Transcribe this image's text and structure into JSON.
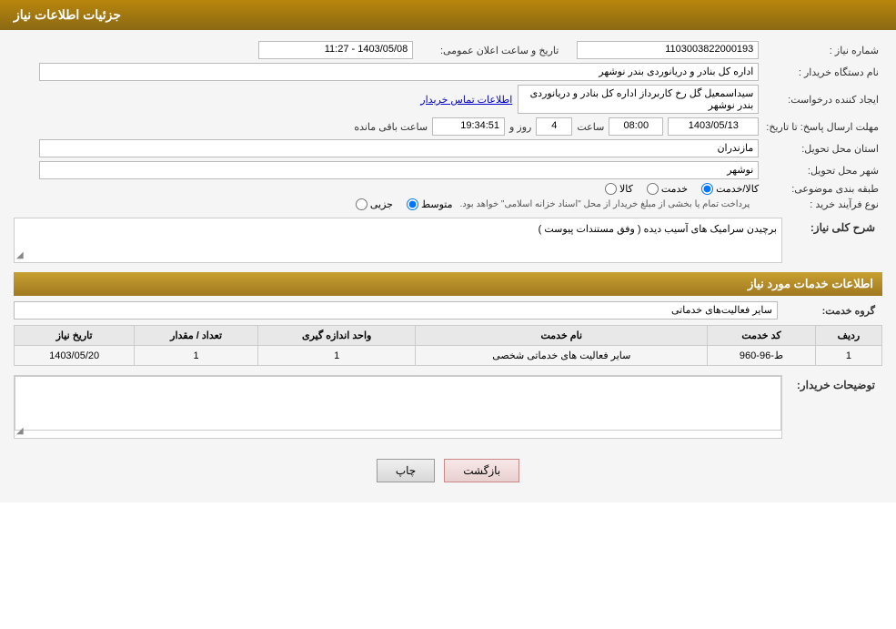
{
  "header": {
    "title": "جزئیات اطلاعات نیاز"
  },
  "fields": {
    "shomareNiaz_label": "شماره نیاز :",
    "shomareNiaz_value": "1103003822000193",
    "namDastgah_label": "نام دستگاه خریدار :",
    "namDastgah_value": "اداره کل بنادر و دریانوردی بندر نوشهر",
    "tarikh_label": "تاریخ و ساعت اعلان عمومی:",
    "tarikh_value": "1403/05/08 - 11:27",
    "ijadKonande_label": "ایجاد کننده درخواست:",
    "ijadKonande_value": "سیداسمعیل گل رخ کاربرداز اداره کل بنادر و دریانوردی بندر نوشهر",
    "ettelaat_link": "اطلاعات تماس خریدار",
    "mohlat_label": "مهلت ارسال پاسخ: تا تاریخ:",
    "date_value": "1403/05/13",
    "saat_label": "ساعت",
    "saat_value": "08:00",
    "roz_label": "روز و",
    "roz_value": "4",
    "time_value": "19:34:51",
    "baghimande_label": "ساعت باقی مانده",
    "ostan_label": "استان محل تحویل:",
    "ostan_value": "مازندران",
    "shahr_label": "شهر محل تحویل:",
    "shahr_value": "نوشهر",
    "tabaghe_label": "طبقه بندی موضوعی:",
    "radio_kala": "کالا",
    "radio_khedmat": "خدمت",
    "radio_kala_khedmat": "کالا/خدمت",
    "noFarayand_label": "نوع فرآیند خرید :",
    "radio_jozyi": "جزیی",
    "radio_motavasset": "متوسط",
    "radio_note": "پرداخت تمام یا بخشی از مبلغ خریدار از محل \"اسناد خزانه اسلامی\" خواهد بود.",
    "sharh_label": "شرح کلی نیاز:",
    "sharh_value": "برچیدن سرامیک های آسیب دیده ( وفق مستندات پیوست )",
    "services_section": "اطلاعات خدمات مورد نیاز",
    "grohe_label": "گروه خدمت:",
    "grohe_value": "سایر فعالیت‌های خدماتی",
    "table_headers": [
      "ردیف",
      "کد خدمت",
      "نام خدمت",
      "واحد اندازه گیری",
      "تعداد / مقدار",
      "تاریخ نیاز"
    ],
    "table_rows": [
      {
        "radif": "1",
        "code": "ط-96-960",
        "name": "سایر فعالیت های خدماتی شخصی",
        "unit": "1",
        "count": "1",
        "date": "1403/05/20"
      }
    ],
    "tozi_label": "توضیحات خریدار:",
    "tozi_value": "",
    "btn_print": "چاپ",
    "btn_back": "بازگشت"
  }
}
